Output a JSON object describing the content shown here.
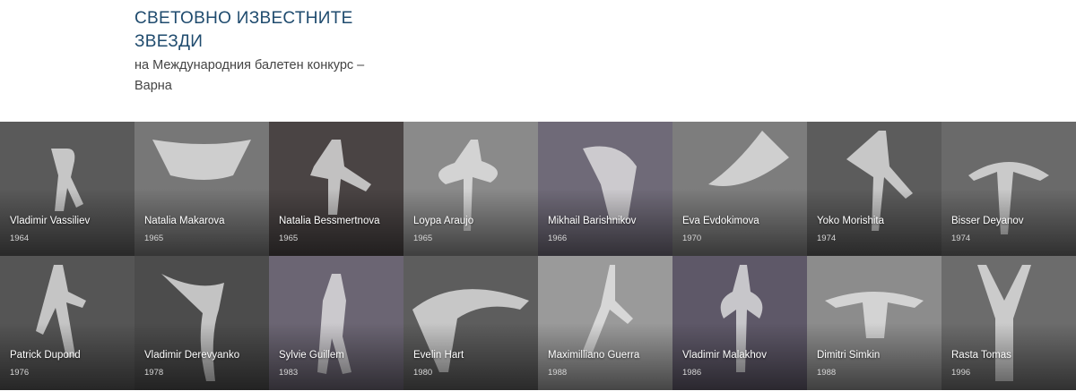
{
  "header": {
    "title": "СВЕТОВНО ИЗВЕСТНИТЕ ЗВЕЗДИ",
    "subtitle": "на Международния балетен конкурс – Варна"
  },
  "dancers": [
    {
      "name": "Vladimir Vassiliev",
      "year": "1964",
      "tone": "#5a5a5a"
    },
    {
      "name": "Natalia Makarova",
      "year": "1965",
      "tone": "#777777"
    },
    {
      "name": "Natalia Bessmertnova",
      "year": "1965",
      "tone": "#4a4444"
    },
    {
      "name": "Loypa Araujo",
      "year": "1965",
      "tone": "#8a8a8a"
    },
    {
      "name": "Mikhail Barishnikov",
      "year": "1966",
      "tone": "#6f6a78"
    },
    {
      "name": "Eva Evdokimova",
      "year": "1970",
      "tone": "#7d7d7d"
    },
    {
      "name": "Yoko Morishita",
      "year": "1974",
      "tone": "#5c5c5c"
    },
    {
      "name": "Bisser Deyanov",
      "year": "1974",
      "tone": "#6a6a6a"
    },
    {
      "name": "Patrick Dupond",
      "year": "1976",
      "tone": "#555555"
    },
    {
      "name": "Vladimir Derevyanko",
      "year": "1978",
      "tone": "#4c4c4c"
    },
    {
      "name": "Sylvie Guillem",
      "year": "1983",
      "tone": "#6b6573"
    },
    {
      "name": "Evelin Hart",
      "year": "1980",
      "tone": "#5d5d5d"
    },
    {
      "name": "Maximilliano Guerra",
      "year": "1988",
      "tone": "#9a9a9a"
    },
    {
      "name": "Vladimir Malakhov",
      "year": "1986",
      "tone": "#5e5868"
    },
    {
      "name": "Dimitri Simkin",
      "year": "1988",
      "tone": "#8c8c8c"
    },
    {
      "name": "Rasta Tomas",
      "year": "1996",
      "tone": "#6c6c6c"
    }
  ]
}
